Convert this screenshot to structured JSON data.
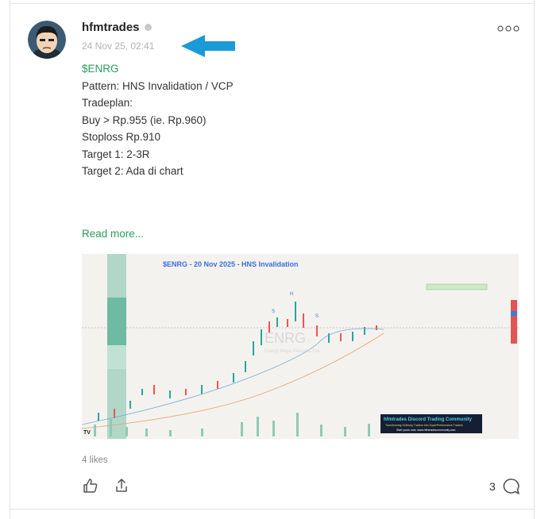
{
  "post": {
    "author": "hfmtrades",
    "timestamp": "24 Nov 25, 02:41",
    "body_lines": [
      "$ENRG",
      "Pattern: HNS Invalidation / VCP",
      "",
      "Tradeplan:",
      "Buy > Rp.955 (ie. Rp.960)",
      "Stoploss Rp.910",
      "Target 1: 2-3R",
      "Target 2: Ada di chart"
    ],
    "read_more": "Read more...",
    "likes": "4 likes",
    "comment_count": "3"
  },
  "chart_image": {
    "title": "$ENRG - 20 Nov 2025 - HNS Invalidation",
    "watermark": "ENRG",
    "watermark_sub": "Energi Mega Persada Tbk",
    "head_label": "H",
    "shoulder_label": "S",
    "community_title": "hfmtrades Discord Trading Community",
    "community_sub": "Transforming Ordinary Traders Into SuperPerformance Traders",
    "community_link": "Start yours now: www.hfmtradescommunity.com",
    "brand_mark": "TV"
  },
  "colors": {
    "accent": "#2a9d5c",
    "arrow": "#1a9ad6",
    "up_candle": "#26a69a",
    "down_candle": "#ef5350"
  },
  "icons": [
    "avatar",
    "verified-icon",
    "more-options-icon",
    "arrow-annotation",
    "like-icon",
    "share-icon",
    "comment-icon"
  ]
}
